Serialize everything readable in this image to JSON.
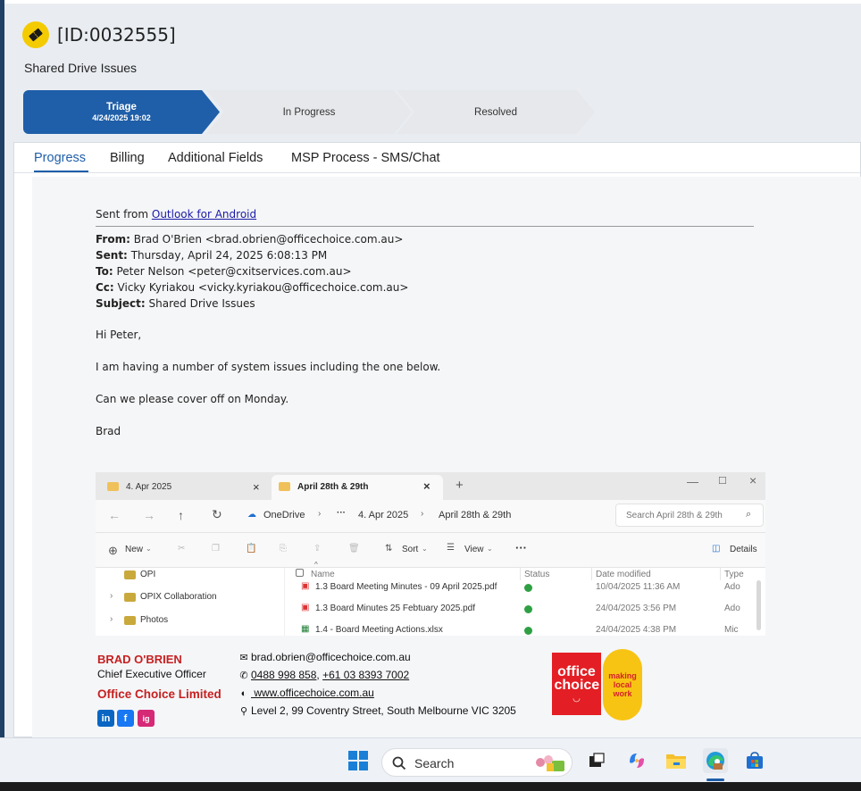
{
  "ticket": {
    "id": "[ID:0032555]",
    "title": "Shared Drive Issues",
    "icon": "ticket-icon"
  },
  "stages": [
    {
      "label": "Triage",
      "date": "4/24/2025 19:02",
      "active": true
    },
    {
      "label": "In Progress",
      "active": false
    },
    {
      "label": "Resolved",
      "active": false
    }
  ],
  "tabs": [
    "Progress",
    "Billing",
    "Additional Fields",
    "MSP Process - SMS/Chat"
  ],
  "active_tab": "Progress",
  "email": {
    "sent_from_prefix": "Sent from ",
    "sent_from_link": "Outlook for Android",
    "headers": {
      "from_label": "From:",
      "from": "Brad O'Brien <brad.obrien@officechoice.com.au>",
      "sent_label": "Sent:",
      "sent": "Thursday, April 24, 2025 6:08:13 PM",
      "to_label": "To:",
      "to": "Peter Nelson <peter@cxitservices.com.au>",
      "cc_label": "Cc:",
      "cc": "Vicky Kyriakou <vicky.kyriakou@officechoice.com.au>",
      "subject_label": "Subject:",
      "subject": "Shared Drive Issues"
    },
    "body": {
      "greeting": "Hi Peter,",
      "line1": "I am having a number of system issues including the one below.",
      "line2": "Can we please cover off on Monday.",
      "signoff": "Brad"
    }
  },
  "explorer": {
    "tab1": "4. Apr 2025",
    "tab2": "April 28th & 29th",
    "breadcrumb": [
      "OneDrive",
      "4. Apr 2025",
      "April 28th & 29th"
    ],
    "search_placeholder": "Search April 28th & 29th",
    "toolbar": {
      "new": "New",
      "sort": "Sort",
      "view": "View",
      "details": "Details"
    },
    "sidebar": [
      "OPI",
      "OPIX Collaboration",
      "Photos"
    ],
    "columns": {
      "name": "Name",
      "status": "Status",
      "date": "Date modified",
      "type": "Type"
    },
    "files": [
      {
        "name": "1.3 Board Meeting Minutes - 09 April 2025.pdf",
        "date": "10/04/2025 11:36 AM",
        "type": "Ado"
      },
      {
        "name": "1.3 Board Minutes 25 Febtuary 2025.pdf",
        "date": "24/04/2025 3:56 PM",
        "type": "Ado"
      },
      {
        "name": "1.4 - Board Meeting Actions.xlsx",
        "date": "24/04/2025 4:38 PM",
        "type": "Mic"
      }
    ]
  },
  "signature": {
    "name": "BRAD O'BRIEN",
    "role": "Chief Executive Officer",
    "company": "Office Choice Limited",
    "email": "brad.obrien@officechoice.com.au",
    "phone1": "0488 998 858",
    "phone_sep": ", ",
    "phone2": "+61 03 8393 7002",
    "website": " www.officechoice.com.au",
    "address": "Level 2, 99 Coventry Street, South Melbourne VIC 3205",
    "social": [
      "in",
      "f",
      "ig"
    ],
    "logo_text": "office choice",
    "logo2_text": "making local work"
  },
  "taskbar": {
    "search_label": "Search",
    "icons": [
      "windows-start-icon",
      "search-icon",
      "task-view-icon",
      "copilot-icon",
      "file-explorer-icon",
      "edge-icon",
      "store-icon"
    ]
  },
  "colors": {
    "accent": "#1f5ea8",
    "brand_red": "#c62020",
    "ticket_yellow": "#f4cb00"
  }
}
